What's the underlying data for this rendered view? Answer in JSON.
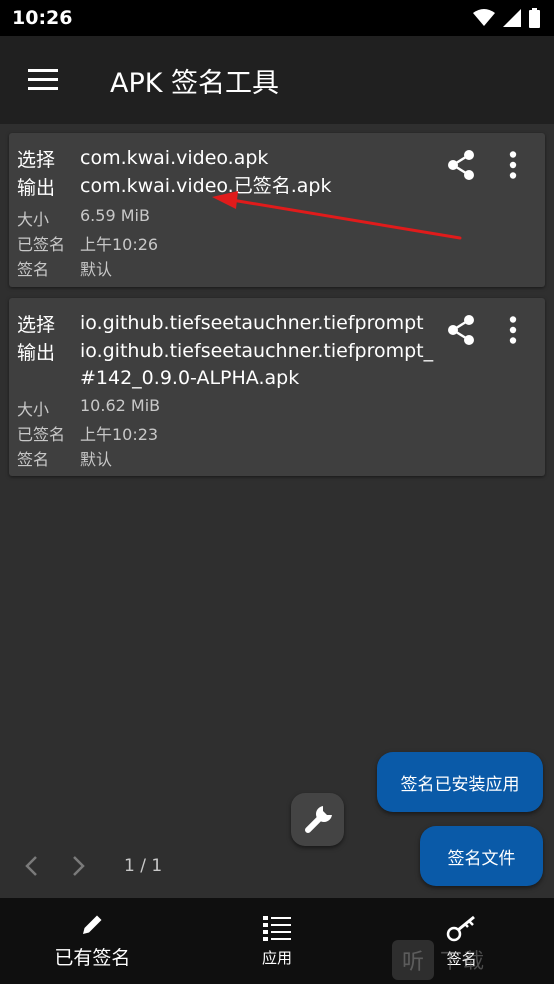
{
  "status": {
    "time": "10:26"
  },
  "app": {
    "title": "APK 签名工具"
  },
  "cards": [
    {
      "select_label": "选择",
      "select_value": "com.kwai.video.apk",
      "output_label": "输出",
      "output_value": "com.kwai.video.已签名.apk",
      "size_label": "大小",
      "size_value": "6.59 MiB",
      "signed_label": "已签名",
      "signed_value": "上午10:26",
      "sign_label": "签名",
      "sign_value": "默认"
    },
    {
      "select_label": "选择",
      "select_value": "io.github.tiefseetauchner.tiefprompt",
      "output_label": "输出",
      "output_line1": "io.github.tiefseetauchner.tiefprompt_",
      "output_line2": "#142_0.9.0-ALPHA.apk",
      "size_label": "大小",
      "size_value": "10.62 MiB",
      "signed_label": "已签名",
      "signed_value": "上午10:23",
      "sign_label": "签名",
      "sign_value": "默认"
    }
  ],
  "actions": {
    "sign_installed": "签名已安装应用",
    "sign_file": "签名文件"
  },
  "pager": {
    "text": "1 / 1"
  },
  "nav": {
    "existing": "已有签名",
    "apps": "应用",
    "sign": "签名"
  },
  "watermark": {
    "box": "听",
    "text": "下载"
  },
  "colors": {
    "accent": "#0a5aa8",
    "card": "#3f3f3f",
    "background": "#2f2f2f",
    "annotation_arrow": "#e01b1b"
  },
  "icons": [
    "menu-icon",
    "share-icon",
    "more-vert-icon",
    "wrench-icon",
    "chevron-left-icon",
    "chevron-right-icon",
    "pencil-icon",
    "list-icon",
    "key-icon",
    "wifi-icon",
    "signal-icon",
    "battery-icon"
  ]
}
